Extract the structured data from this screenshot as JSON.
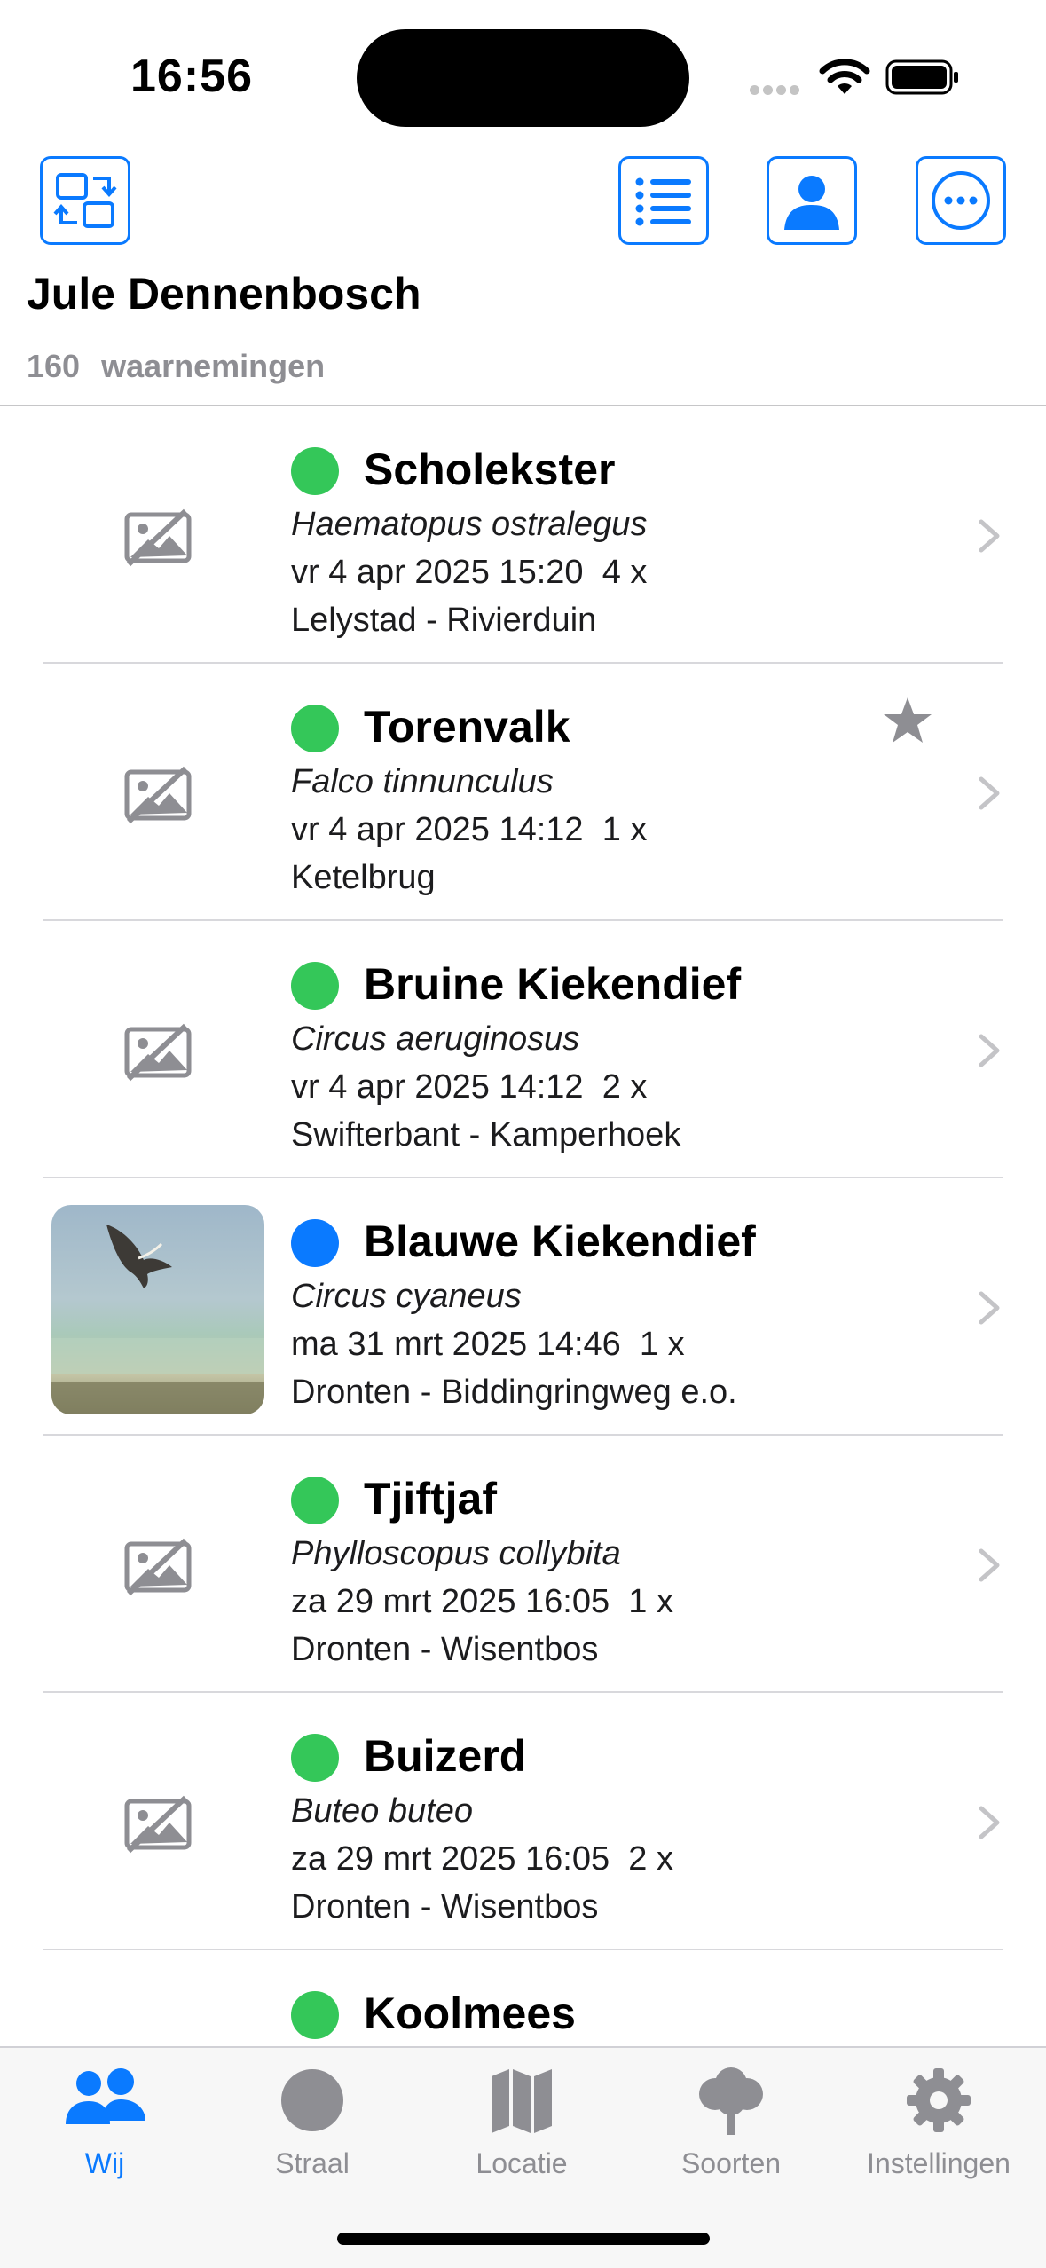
{
  "status_bar": {
    "time": "16:56"
  },
  "toolbar": {
    "switch_icon": "switch-accounts-icon",
    "list_icon": "list-icon",
    "profile_icon": "person-icon",
    "more_icon": "more-icon",
    "accent_color": "#0a7aff"
  },
  "header": {
    "user_name": "Jule Dennenbosch",
    "count": "160",
    "count_label": "waarnemingen"
  },
  "observations": [
    {
      "name": "Scholekster",
      "latin": "Haematopus ostralegus",
      "date": "vr 4 apr 2025 15:20",
      "qty": "4 x",
      "place": "Lelystad - Rivierduin",
      "dot_color": "#34c759",
      "has_photo": false,
      "starred": false
    },
    {
      "name": "Torenvalk",
      "latin": "Falco tinnunculus",
      "date": "vr 4 apr 2025 14:12",
      "qty": "1 x",
      "place": "Ketelbrug",
      "dot_color": "#34c759",
      "has_photo": false,
      "starred": true
    },
    {
      "name": "Bruine Kiekendief",
      "latin": "Circus aeruginosus",
      "date": "vr 4 apr 2025 14:12",
      "qty": "2 x",
      "place": "Swifterbant - Kamperhoek",
      "dot_color": "#34c759",
      "has_photo": false,
      "starred": false
    },
    {
      "name": "Blauwe Kiekendief",
      "latin": "Circus cyaneus",
      "date": "ma 31 mrt 2025 14:46",
      "qty": "1 x",
      "place": "Dronten - Biddingringweg e.o.",
      "dot_color": "#0a7aff",
      "has_photo": true,
      "starred": false
    },
    {
      "name": "Tjiftjaf",
      "latin": "Phylloscopus collybita",
      "date": "za 29 mrt 2025 16:05",
      "qty": "1 x",
      "place": "Dronten - Wisentbos",
      "dot_color": "#34c759",
      "has_photo": false,
      "starred": false
    },
    {
      "name": "Buizerd",
      "latin": "Buteo buteo",
      "date": "za 29 mrt 2025 16:05",
      "qty": "2 x",
      "place": "Dronten - Wisentbos",
      "dot_color": "#34c759",
      "has_photo": false,
      "starred": false
    },
    {
      "name": "Koolmees",
      "latin": "",
      "date": "",
      "qty": "",
      "place": "",
      "dot_color": "#34c759",
      "has_photo": false,
      "starred": false
    }
  ],
  "tabs": [
    {
      "label": "Wij",
      "icon": "people-icon",
      "active": true
    },
    {
      "label": "Straal",
      "icon": "circle-icon",
      "active": false
    },
    {
      "label": "Locatie",
      "icon": "map-icon",
      "active": false
    },
    {
      "label": "Soorten",
      "icon": "tree-icon",
      "active": false
    },
    {
      "label": "Instellingen",
      "icon": "gear-icon",
      "active": false
    }
  ]
}
